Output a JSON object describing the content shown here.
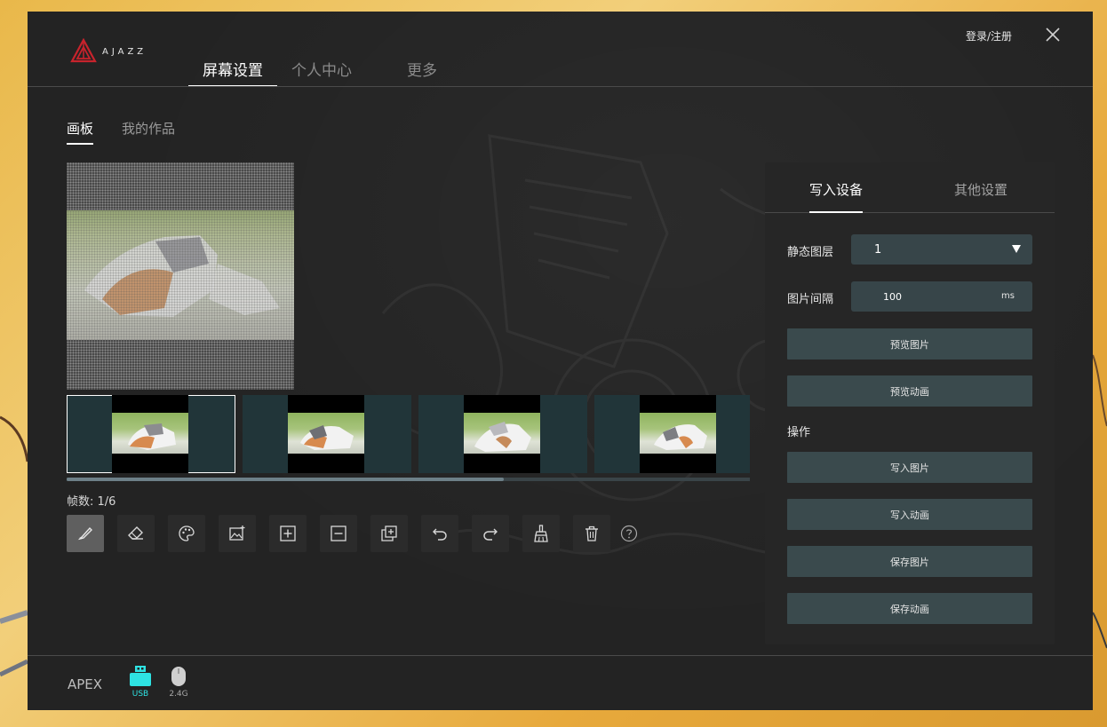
{
  "app": {
    "logo_text": "AJAZZ",
    "login_label": "登录/注册"
  },
  "main_tabs": [
    {
      "label": "屏幕设置",
      "active": true
    },
    {
      "label": "个人中心",
      "active": false
    },
    {
      "label": "更多",
      "active": false
    }
  ],
  "sub_tabs": [
    {
      "label": "画板",
      "active": true
    },
    {
      "label": "我的作品",
      "active": false
    }
  ],
  "frames": {
    "count_label": "帧数: 1/6",
    "current": 1,
    "total": 6,
    "visible_thumbnails": 4,
    "selected_index": 0,
    "scroll_fraction_visible": 0.64
  },
  "tools": [
    {
      "icon": "brush-icon",
      "active": true
    },
    {
      "icon": "eraser-icon",
      "active": false
    },
    {
      "icon": "palette-icon",
      "active": false
    },
    {
      "icon": "image-add-icon",
      "active": false
    },
    {
      "icon": "frame-add-icon",
      "active": false
    },
    {
      "icon": "frame-remove-icon",
      "active": false
    },
    {
      "icon": "frame-copy-icon",
      "active": false
    },
    {
      "icon": "undo-icon",
      "active": false
    },
    {
      "icon": "redo-icon",
      "active": false
    },
    {
      "icon": "clear-brush-icon",
      "active": false
    },
    {
      "icon": "trash-icon",
      "active": false
    },
    {
      "icon": "help-icon",
      "active": false
    }
  ],
  "panel": {
    "tabs": [
      {
        "label": "写入设备",
        "active": true
      },
      {
        "label": "其他设置",
        "active": false
      }
    ],
    "static_layer_label": "静态图层",
    "static_layer_value": "1",
    "interval_label": "图片间隔",
    "interval_value": "100",
    "interval_unit": "ms",
    "preview_image": "预览图片",
    "preview_animation": "预览动画",
    "operation_label": "操作",
    "write_image": "写入图片",
    "write_animation": "写入动画",
    "save_image": "保存图片",
    "save_animation": "保存动画"
  },
  "footer": {
    "device_name": "APEX",
    "usb_label": "USB",
    "wireless_label": "2.4G",
    "usb_active": true
  },
  "colors": {
    "window_bg": "#232323",
    "panel_btn": "#3a4a4d",
    "frame_bg": "#213539",
    "usb_active": "#2ee3e3",
    "logo_red": "#c8232c"
  }
}
